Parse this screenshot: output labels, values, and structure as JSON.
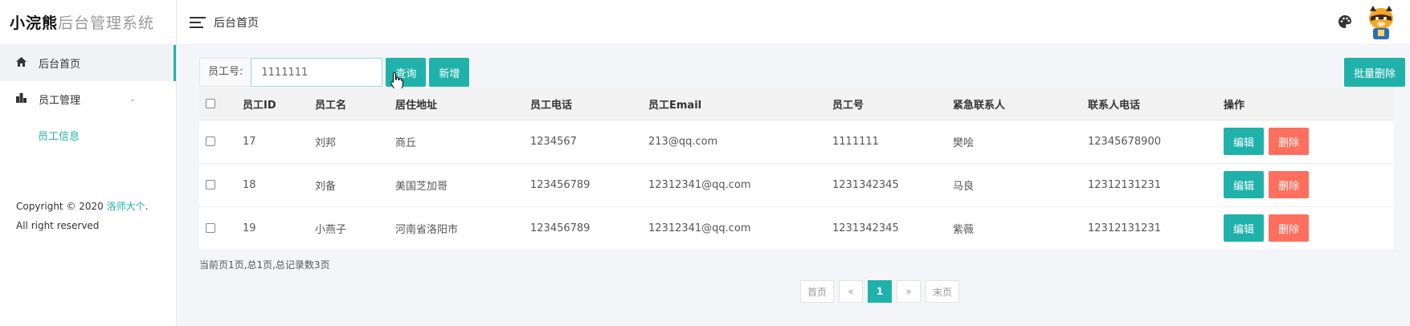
{
  "brand": {
    "strong": "小浣熊",
    "light": "后台管理系统"
  },
  "header": {
    "breadcrumb": "后台首页"
  },
  "sidebar": {
    "items": [
      {
        "label": "后台首页",
        "icon": "home-icon"
      },
      {
        "label": "员工管理",
        "icon": "building-icon"
      }
    ],
    "sub_items": [
      {
        "label": "员工信息"
      }
    ],
    "copyright": {
      "prefix": "Copyright © 2020 ",
      "link": "洛师大个",
      "suffix": ". All right reserved"
    }
  },
  "toolbar": {
    "field_label": "员工号:",
    "search_value": "1111111",
    "query_label": "查询",
    "add_label": "新增",
    "batch_delete_label": "批量删除"
  },
  "table": {
    "headers": [
      "员工ID",
      "员工名",
      "居住地址",
      "员工电话",
      "员工Email",
      "员工号",
      "紧急联系人",
      "联系人电话",
      "操作"
    ],
    "rows": [
      [
        "17",
        "刘邦",
        "商丘",
        "1234567",
        "213@qq.com",
        "1111111",
        "樊哙",
        "12345678900"
      ],
      [
        "18",
        "刘备",
        "美国芝加哥",
        "123456789",
        "12312341@qq.com",
        "1231342345",
        "马良",
        "12312131231"
      ],
      [
        "19",
        "小燕子",
        "河南省洛阳市",
        "123456789",
        "12312341@qq.com",
        "1231342345",
        "紫薇",
        "12312131231"
      ]
    ],
    "edit_label": "编辑",
    "delete_label": "删除"
  },
  "footer": {
    "page_info": "当前页1页,总1页,总记录数3页",
    "pagination": {
      "first": "首页",
      "prev": "«",
      "current": "1",
      "next": "»",
      "last": "末页"
    }
  },
  "colors": {
    "accent": "#20b2aa",
    "danger": "#ff6f5e"
  }
}
